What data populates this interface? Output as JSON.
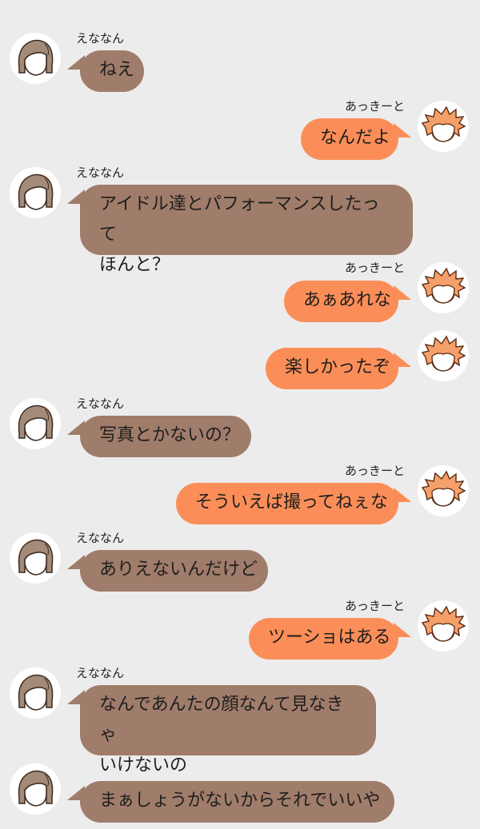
{
  "participants": {
    "left_name": "えななん",
    "right_name": "あっきーと"
  },
  "messages": [
    {
      "side": "left",
      "text": "ねえ"
    },
    {
      "side": "right",
      "text": "なんだよ"
    },
    {
      "side": "left",
      "text": "アイドル達とパフォーマンスしたってほんと？"
    },
    {
      "side": "right",
      "text": "あぁあれな"
    },
    {
      "side": "right",
      "text": "楽しかったぞ"
    },
    {
      "side": "left",
      "text": "写真とかないの？"
    },
    {
      "side": "right",
      "text": "そういえば撮ってねぇな"
    },
    {
      "side": "left",
      "text": "ありえないんだけど"
    },
    {
      "side": "right",
      "text": "ツーショはある"
    },
    {
      "side": "left",
      "text": "なんであんたの顔なんて見なきゃいけないの"
    },
    {
      "side": "left",
      "text": "まぁしょうがないからそれでいいや"
    }
  ],
  "colors": {
    "left_bubble": "#a07c6a",
    "right_bubble": "#fb8e58",
    "background": "#ececec"
  },
  "icons": {
    "left_avatar": "brown-hair-girl-avatar-icon",
    "right_avatar": "orange-hair-boy-avatar-icon"
  }
}
